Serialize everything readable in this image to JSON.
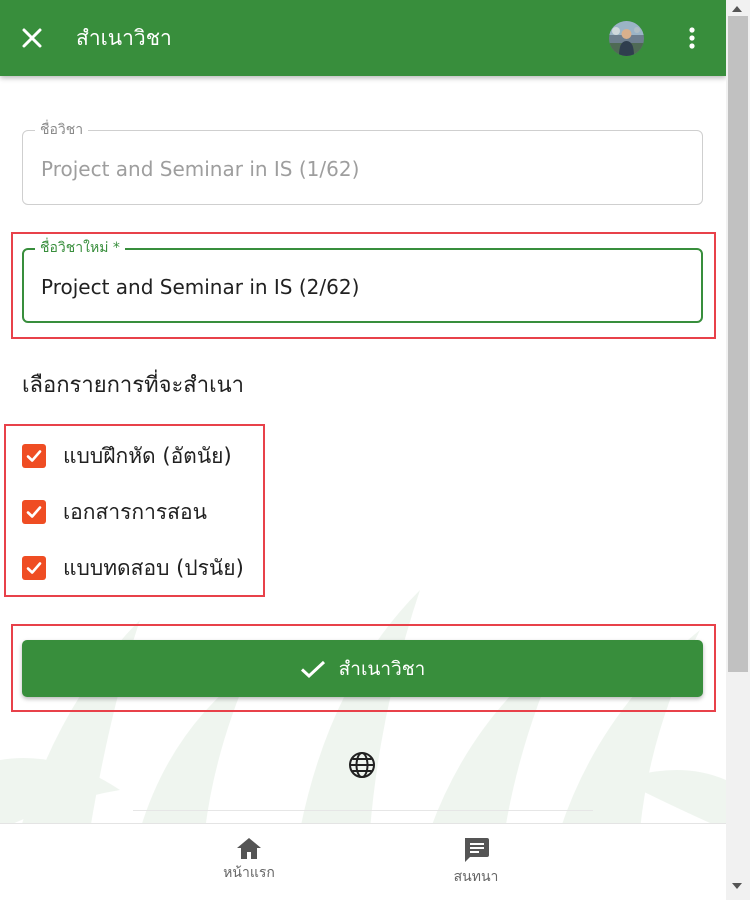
{
  "colors": {
    "primary": "#388e3c",
    "checkbox": "#ef4d23",
    "highlight": "#e8414a"
  },
  "header": {
    "title": "สำเนาวิชา",
    "close_icon": "close-icon",
    "more_icon": "more-vertical-icon"
  },
  "form": {
    "old_name": {
      "label": "ชื่อวิชา",
      "value": "Project and Seminar in IS (1/62)"
    },
    "new_name": {
      "label": "ชื่อวิชาใหม่ *",
      "value": "Project and Seminar in IS (2/62)"
    },
    "section_title": "เลือกรายการที่จะสำเนา",
    "options": [
      {
        "label": "แบบฝึกหัด (อัตนัย)",
        "checked": true
      },
      {
        "label": "เอกสารการสอน",
        "checked": true
      },
      {
        "label": "แบบทดสอบ (ปรนัย)",
        "checked": true
      }
    ],
    "submit_label": "สำเนาวิชา"
  },
  "bottom_nav": {
    "items": [
      {
        "label": "หน้าแรก",
        "icon": "home-icon"
      },
      {
        "label": "สนทนา",
        "icon": "chat-icon"
      }
    ]
  }
}
